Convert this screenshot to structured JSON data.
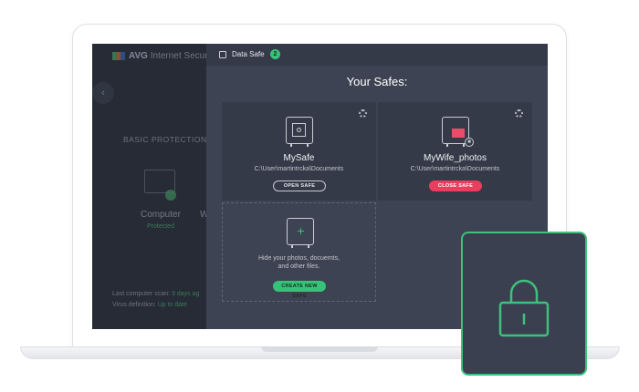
{
  "background_app": {
    "title_brand": "AVG",
    "title_rest": "Internet Securi",
    "back_icon": "chevron-left-icon",
    "section_label": "BASIC PROTECTION",
    "computer_label": "Computer",
    "computer_status": "Protected",
    "partial_label": "W",
    "last_scan_label": "Last computer scan:",
    "last_scan_value": "3 days ag",
    "virus_def_label": "Virus definition:",
    "virus_def_value": "Up to date"
  },
  "panel": {
    "header_title": "Data Safe",
    "header_badge": "2",
    "heading": "Your Safes:",
    "safes": [
      {
        "name": "MySafe",
        "path": "C:\\User\\martintrcka\\Documents",
        "button_label": "OPEN SAFE",
        "state": "closed"
      },
      {
        "name": "MyWife_photos",
        "path": "C:\\User\\martintrcka\\Documents",
        "button_label": "CLOSE SAFE",
        "state": "open"
      }
    ],
    "new_safe": {
      "description_line1": "Hide your photos, docuemts,",
      "description_line2": "and other files.",
      "button_label": "CREATE NEW SAFE"
    }
  },
  "colors": {
    "accent_green": "#37c27a",
    "danger_red": "#ea3e5f",
    "panel_bg": "#3d4352",
    "card_bg": "#343a47"
  }
}
